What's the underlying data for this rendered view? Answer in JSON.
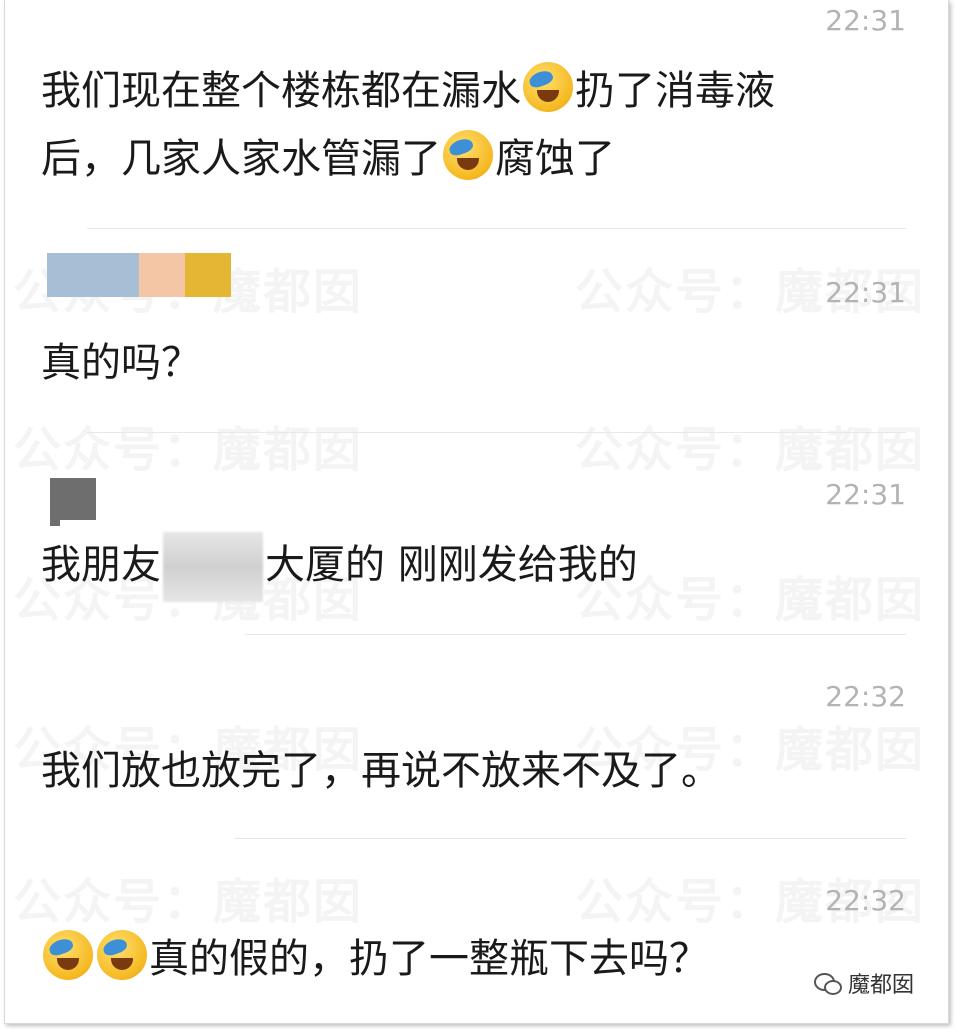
{
  "watermark": "公众号：魔都囡",
  "messages": [
    {
      "time": "22:31",
      "line1_a": "我们现在整个楼栋都在漏水",
      "line1_b": "扔了消毒液",
      "line2_a": "后，几家人家水管漏了",
      "line2_b": "腐蚀了"
    },
    {
      "time": "22:31",
      "text": "真的吗？",
      "avatar_colors": [
        "#a7bfd4",
        "#f5c6a6",
        "#e4b634"
      ]
    },
    {
      "time": "22:31",
      "text_a": "我朋友",
      "text_b": "大厦的 刚刚发给我的"
    },
    {
      "time": "22:32",
      "text": "我们放也放完了，再说不放来不及了。"
    },
    {
      "time": "22:32",
      "text": "真的假的，扔了一整瓶下去吗？"
    }
  ],
  "emoji_icon": "face-with-tears-of-joy-icon",
  "footer": {
    "logo_text": "魔都囡",
    "icon": "wechat-icon"
  }
}
